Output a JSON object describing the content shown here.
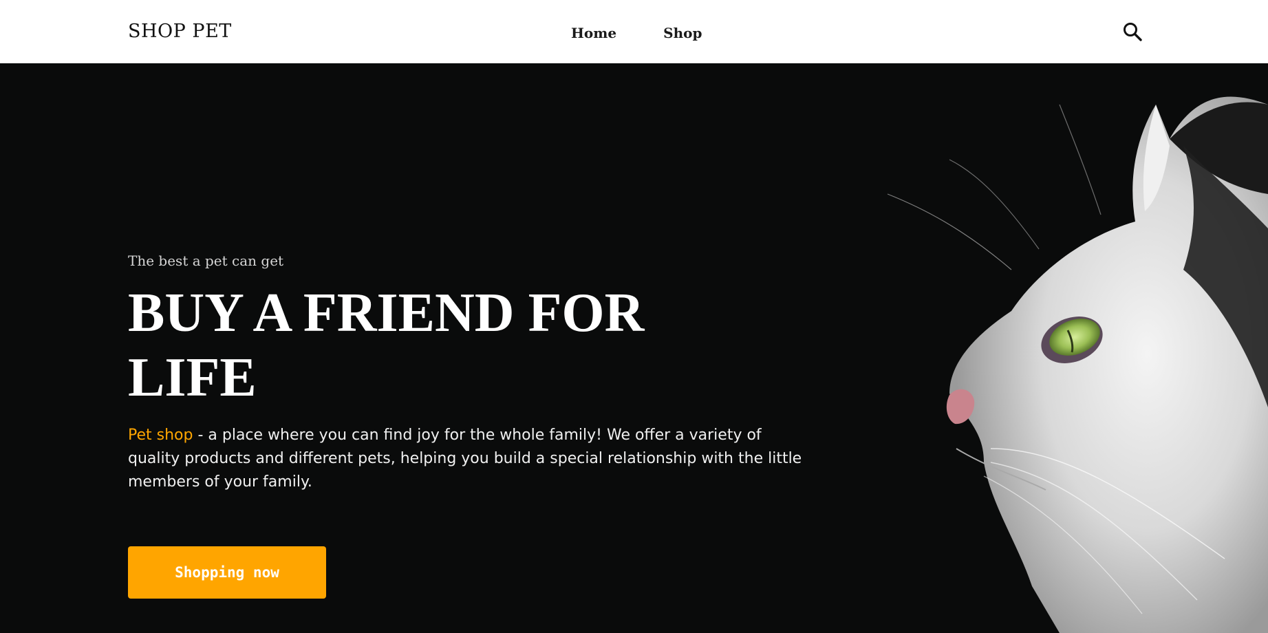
{
  "header": {
    "logo": "SHOP PET",
    "nav": [
      {
        "label": "Home"
      },
      {
        "label": "Shop"
      }
    ],
    "search_icon": "search-icon"
  },
  "hero": {
    "eyebrow": "The best a pet can get",
    "headline": "BUY A FRIEND FOR LIFE",
    "description_highlight": "Pet shop",
    "description_rest": " - a place where you can find joy for the whole family! We offer a variety of quality products and different pets, helping you build a special relationship with the little members of your family.",
    "cta_label": "Shopping now",
    "image": "white-cat-profile"
  },
  "colors": {
    "accent": "#ffa500",
    "hero_background": "#0a0b0b",
    "header_background": "#ffffff"
  }
}
